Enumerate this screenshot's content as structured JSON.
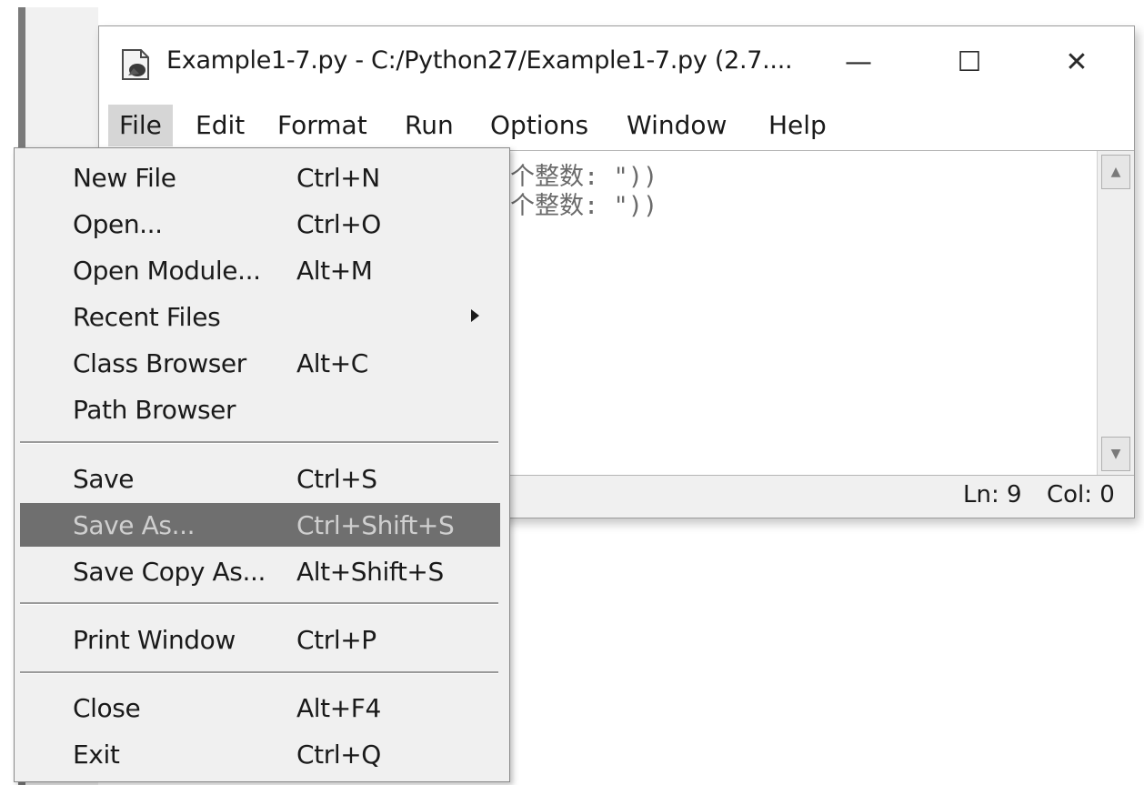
{
  "window": {
    "title": "Example1-7.py - C:/Python27/Example1-7.py (2.7....",
    "minimize_glyph": "—",
    "maximize_glyph": "☐",
    "close_glyph": "✕"
  },
  "menubar": {
    "items": [
      {
        "label": "File"
      },
      {
        "label": "Edit"
      },
      {
        "label": "Format"
      },
      {
        "label": "Run"
      },
      {
        "label": "Options"
      },
      {
        "label": "Window"
      },
      {
        "label": "Help"
      }
    ],
    "active": "File"
  },
  "editor": {
    "visible_lines": [
      "个整数: \"))",
      "个整数: \"))"
    ]
  },
  "statusbar": {
    "ln": "Ln: 9",
    "col": "Col: 0"
  },
  "file_menu": {
    "items": [
      {
        "label": "New File",
        "shortcut": "Ctrl+N"
      },
      {
        "label": "Open...",
        "shortcut": "Ctrl+O"
      },
      {
        "label": "Open Module...",
        "shortcut": "Alt+M"
      },
      {
        "label": "Recent Files",
        "shortcut": "",
        "submenu": true
      },
      {
        "label": "Class Browser",
        "shortcut": "Alt+C"
      },
      {
        "label": "Path Browser",
        "shortcut": ""
      },
      {
        "label": "Save",
        "shortcut": "Ctrl+S"
      },
      {
        "label": "Save As...",
        "shortcut": "Ctrl+Shift+S",
        "highlighted": true
      },
      {
        "label": "Save Copy As...",
        "shortcut": "Alt+Shift+S"
      },
      {
        "label": "Print Window",
        "shortcut": "Ctrl+P"
      },
      {
        "label": "Close",
        "shortcut": "Alt+F4"
      },
      {
        "label": "Exit",
        "shortcut": "Ctrl+Q"
      }
    ]
  },
  "icons": {
    "app": "python-idle-icon",
    "scroll_up": "scroll-up-arrow-icon",
    "scroll_down": "scroll-down-arrow-icon",
    "submenu": "submenu-arrow-icon"
  },
  "colors": {
    "highlight": "#6f6f6f",
    "menu_bg": "#f0f0f0",
    "active_menu": "#d6d6d6"
  }
}
